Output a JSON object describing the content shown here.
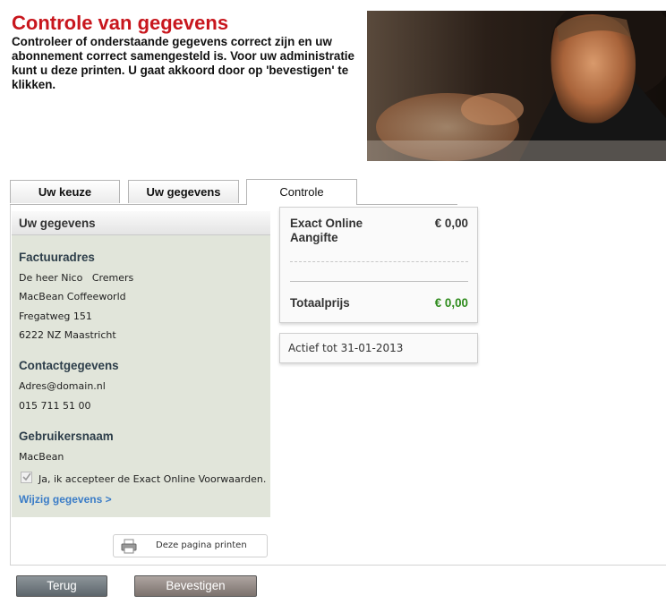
{
  "header": {
    "title": "Controle van gegevens",
    "intro": "Controleer of onderstaande gegevens correct zijn en uw abonnement correct samengesteld is. Voor uw administratie kunt u deze printen. U gaat akkoord door op 'bevestigen' te klikken."
  },
  "tabs": [
    {
      "label": "Uw keuze",
      "active": false
    },
    {
      "label": "Uw gegevens",
      "active": false
    },
    {
      "label": "Controle",
      "active": true
    }
  ],
  "details": {
    "panel_title": "Uw gegevens",
    "invoice": {
      "heading": "Factuuradres",
      "lines": [
        "De heer Nico   Cremers",
        "MacBean Coffeeworld",
        "Fregatweg 151",
        "6222 NZ Maastricht"
      ]
    },
    "contact": {
      "heading": "Contactgegevens",
      "lines": [
        "Adres@domain.nl",
        "015 711 51 00"
      ]
    },
    "user": {
      "heading": "Gebruikersnaam",
      "lines": [
        "MacBean"
      ]
    },
    "terms": {
      "label": "Ja, ik accepteer de Exact Online Voorwaarden.",
      "checked": true
    },
    "edit_link": "Wijzig gegevens >"
  },
  "print_button": {
    "label": "Deze pagina printen",
    "icon": "printer-icon"
  },
  "summary": {
    "product": "Exact Online Aangifte",
    "product_price": "€ 0,00",
    "total_label": "Totaalprijs",
    "total_price": "€ 0,00",
    "total_color": "#2e8b1c"
  },
  "active_until": "Actief tot 31-01-2013",
  "buttons": {
    "back": "Terug",
    "confirm": "Bevestigen"
  },
  "colors": {
    "title": "#c8161d",
    "link": "#3a7cc7",
    "panel_bg": "#e1e5da"
  }
}
